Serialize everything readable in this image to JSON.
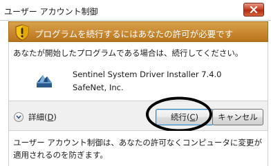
{
  "window": {
    "title": "ユーザー アカウント制御",
    "close_icon": "close-icon",
    "close_color": "#c8452a"
  },
  "banner": {
    "text": "プログラムを続行するにはあなたの許可が必要です",
    "icon": "shield-warning-icon",
    "color": "#c88830"
  },
  "content": {
    "question": "あなたが開始したプログラムである場合は、続行してください。",
    "program_name": "Sentinel System Driver Installer 7.4.0",
    "publisher": "SafeNet, Inc.",
    "program_icon": "installer-icon"
  },
  "buttons": {
    "details_prefix": "詳細(",
    "details_key": "D",
    "details_suffix": ")",
    "continue_prefix": "続行(",
    "continue_key": "C",
    "continue_suffix": ")",
    "cancel": "キャンセル"
  },
  "footer": {
    "text": "ユーザー アカウント制御は、あなたの許可なくコンピュータに変更が適用されるのを防ぎます。"
  }
}
